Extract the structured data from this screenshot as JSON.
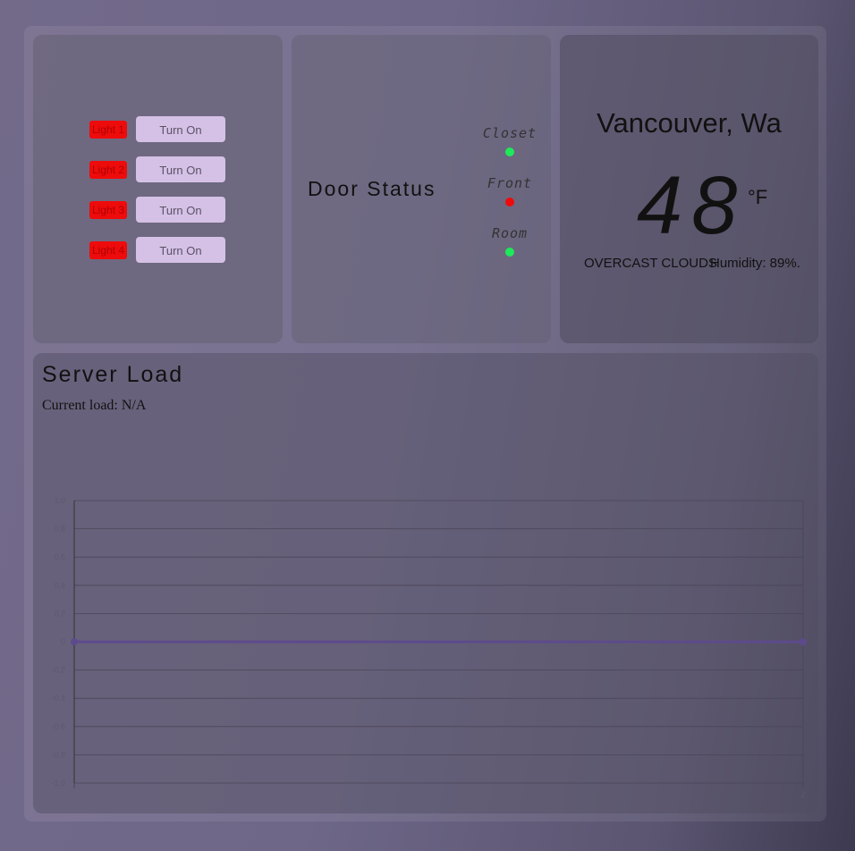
{
  "lights": [
    {
      "label": "Light 1",
      "button": "Turn On"
    },
    {
      "label": "Light 2",
      "button": "Turn On"
    },
    {
      "label": "Light 3",
      "button": "Turn On"
    },
    {
      "label": "Light 4",
      "button": "Turn On"
    }
  ],
  "doors": {
    "title": "Door Status",
    "items": [
      {
        "label": "Closet",
        "status": "closed",
        "color": "#1de95a"
      },
      {
        "label": "Front",
        "status": "open",
        "color": "#ee0b0b"
      },
      {
        "label": "Room",
        "status": "closed",
        "color": "#1de95a"
      }
    ]
  },
  "weather": {
    "city": "Vancouver, Wa",
    "temperature": "48",
    "unit": "°F",
    "description": "OVERCAST CLOUDS",
    "humidity": "Humidity: 89%."
  },
  "server": {
    "title": "Server Load",
    "current_load": "Current load: N/A"
  },
  "chart_data": {
    "type": "line",
    "x": [
      0,
      2
    ],
    "series": [
      {
        "values": [
          0,
          0
        ],
        "color": "#5d4a8c"
      }
    ],
    "y_ticks": [
      "1.0",
      "0.8",
      "0.6",
      "0.4",
      "0.2",
      "0",
      "-0.2",
      "-0.4",
      "-0.6",
      "-0.8",
      "-1.0"
    ],
    "x_ticks": [
      "",
      "2"
    ],
    "ylim": [
      -1,
      1
    ],
    "grid": true
  }
}
